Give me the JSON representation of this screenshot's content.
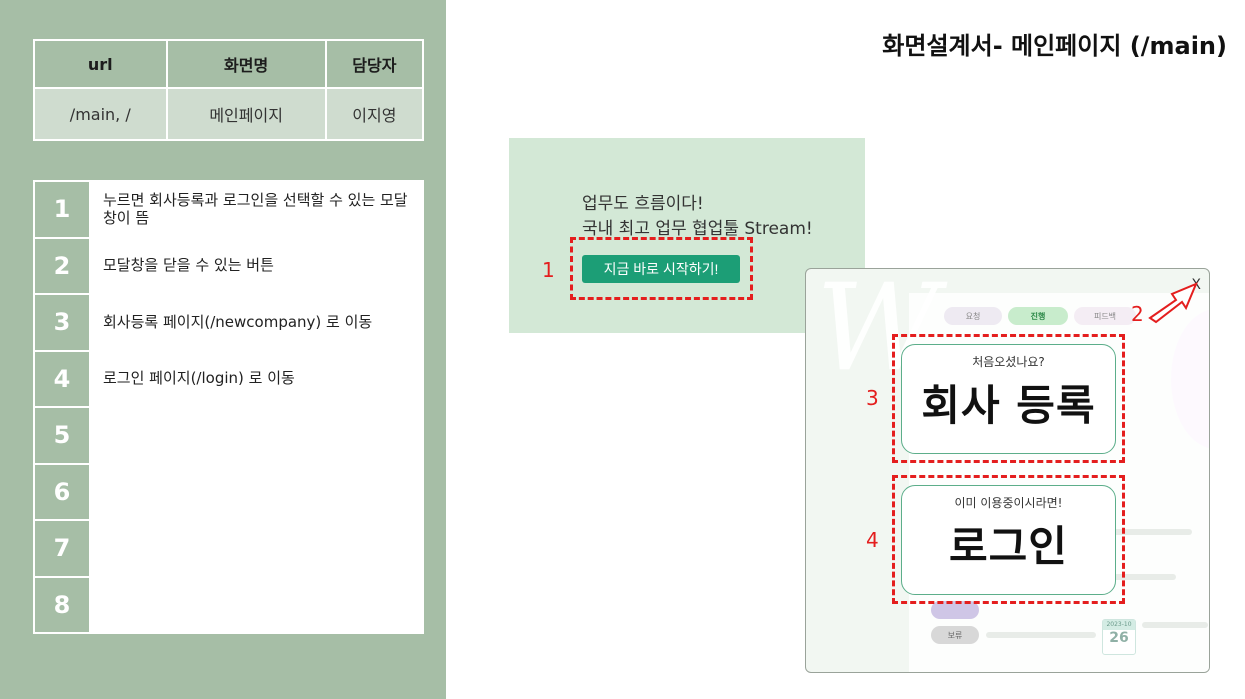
{
  "doc_title": "화면설계서- 메인페이지 (/main)",
  "meta_table": {
    "headers": [
      "url",
      "화면명",
      "담당자"
    ],
    "values": [
      "/main, /",
      "메인페이지",
      "이지영"
    ]
  },
  "description_rows": [
    {
      "num": "1",
      "text": "누르면 회사등록과 로그인을 선택할 수 있는 모달창이 뜸"
    },
    {
      "num": "2",
      "text": "모달창을 닫을 수 있는 버튼"
    },
    {
      "num": "3",
      "text": "회사등록 페이지(/newcompany) 로 이동"
    },
    {
      "num": "4",
      "text": "로그인 페이지(/login) 로 이동"
    },
    {
      "num": "5",
      "text": ""
    },
    {
      "num": "6",
      "text": ""
    },
    {
      "num": "7",
      "text": ""
    },
    {
      "num": "8",
      "text": ""
    }
  ],
  "hero": {
    "line1": "업무도 흐름이다!",
    "line2": "국내 최고 업무 협업툴 Stream!",
    "start_button": "지금 바로 시작하기!"
  },
  "modal": {
    "close_label": "X",
    "register_card": {
      "sub": "처음오셨나요?",
      "main": "회사 등록"
    },
    "login_card": {
      "sub": "이미 이용중이시라면!",
      "main": "로그인"
    },
    "bg_tabs": [
      "요청",
      "진행",
      "피드백"
    ],
    "bg_badge": "보류",
    "bg_calendar": {
      "month": "2023-10",
      "day": "26"
    }
  },
  "markers": [
    "1",
    "2",
    "3",
    "4"
  ],
  "colors": {
    "sidebar": "#a6bea6",
    "accent_green": "#1c9e76",
    "hero_bg": "#d3e8d6",
    "marker_red": "#e41e1e"
  }
}
